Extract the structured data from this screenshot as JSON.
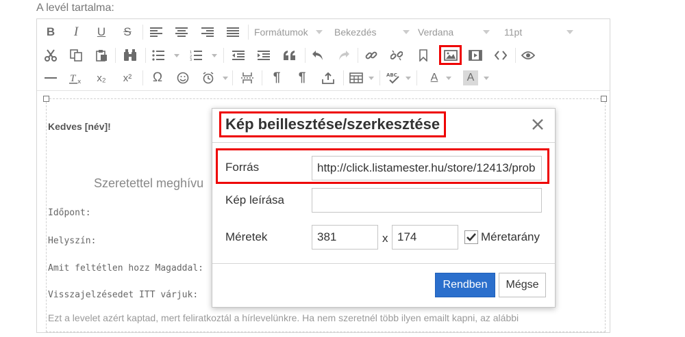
{
  "section_label": "A levél tartalma:",
  "toolbar": {
    "formats": "Formátumok",
    "paragraph": "Bekezdés",
    "font_family": "Verdana",
    "font_size": "11pt",
    "icons": {
      "bold": "B",
      "italic": "I",
      "underline": "U",
      "strikethrough": "S",
      "subscript": "x₂",
      "superscript": "x²",
      "omega": "Ω",
      "pilcrow": "¶",
      "text_color": "A",
      "bg_color": "A"
    }
  },
  "content": {
    "greeting": "Kedves [név]!",
    "invite": "Szeretettel meghívu",
    "time_label": "Időpont:",
    "place_label": "Helyszín:",
    "bring_label": "Amit feltétlen hozz Magaddal:",
    "feedback_label": "Visszajelzésedet ITT várjuk:",
    "footer": "Ezt a levelet azért kaptad, mert feliratkoztál a hírlevelünkre. Ha nem szeretnél több ilyen emailt kapni, az alábbi"
  },
  "dialog": {
    "title": "Kép beillesztése/szerkesztése",
    "source_label": "Forrás",
    "source_value": "http://click.listamester.hu/store/12413/prob",
    "alt_label": "Kép leírása",
    "alt_value": "",
    "dimensions_label": "Méretek",
    "width_value": "381",
    "x_separator": "x",
    "height_value": "174",
    "aspect_label": "Méretarány",
    "ok_label": "Rendben",
    "cancel_label": "Mégse"
  },
  "colors": {
    "highlight": "#e00000",
    "primary_button": "#2b6fcc",
    "icon": "#6b6b6b"
  }
}
